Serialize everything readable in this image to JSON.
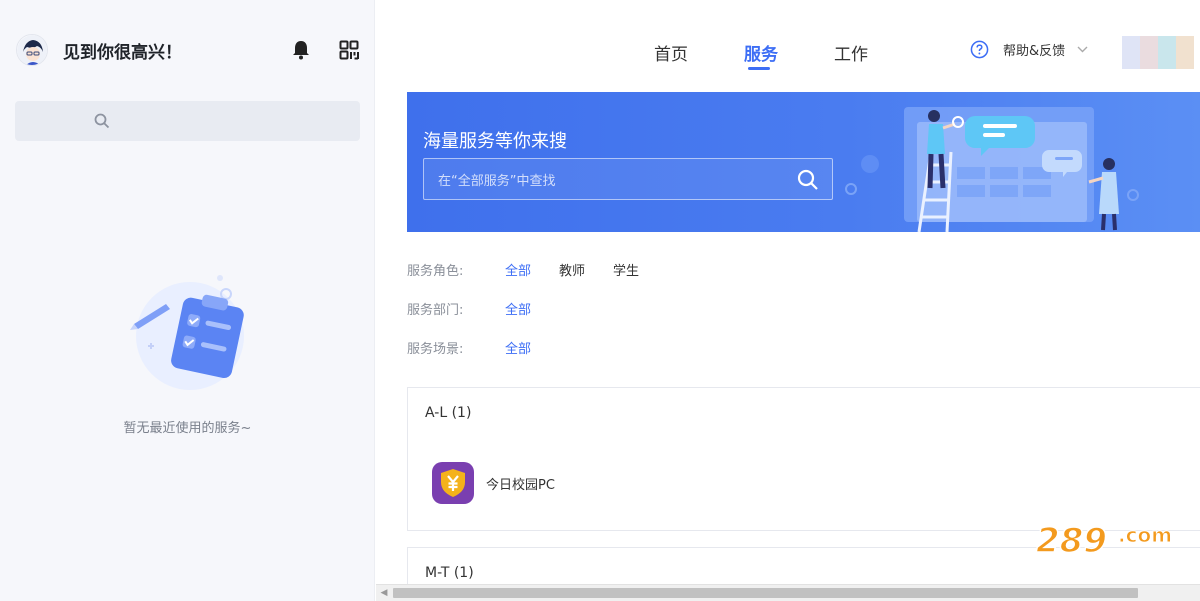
{
  "sidebar": {
    "greeting": "见到你很高兴！",
    "empty_text": "暂无最近使用的服务~"
  },
  "nav": {
    "tabs": [
      {
        "label": "首页",
        "active": false
      },
      {
        "label": "服务",
        "active": true
      },
      {
        "label": "工作",
        "active": false
      }
    ],
    "help_label": "帮助&反馈"
  },
  "banner": {
    "title": "海量服务等你来搜",
    "search_placeholder": "在“全部服务”中查找"
  },
  "filters": {
    "rows": [
      {
        "label": "服务角色:",
        "options": [
          "全部",
          "教师",
          "学生"
        ],
        "selected": "全部"
      },
      {
        "label": "服务部门:",
        "options": [
          "全部"
        ],
        "selected": "全部"
      },
      {
        "label": "服务场景:",
        "options": [
          "全部"
        ],
        "selected": "全部"
      }
    ]
  },
  "groups": [
    {
      "title": "A-L (1)",
      "services": [
        {
          "name": "今日校园PC",
          "icon": "shield-yen-icon"
        }
      ]
    },
    {
      "title": "M-T (1)",
      "services": []
    }
  ],
  "colors": {
    "accent": "#3d6ef5",
    "banner": "#4a7cf0",
    "sidebar_bg": "#f6f7fb",
    "service_icon_bg": "#7a3fb0",
    "watermark_orange": "#f39a1e"
  }
}
